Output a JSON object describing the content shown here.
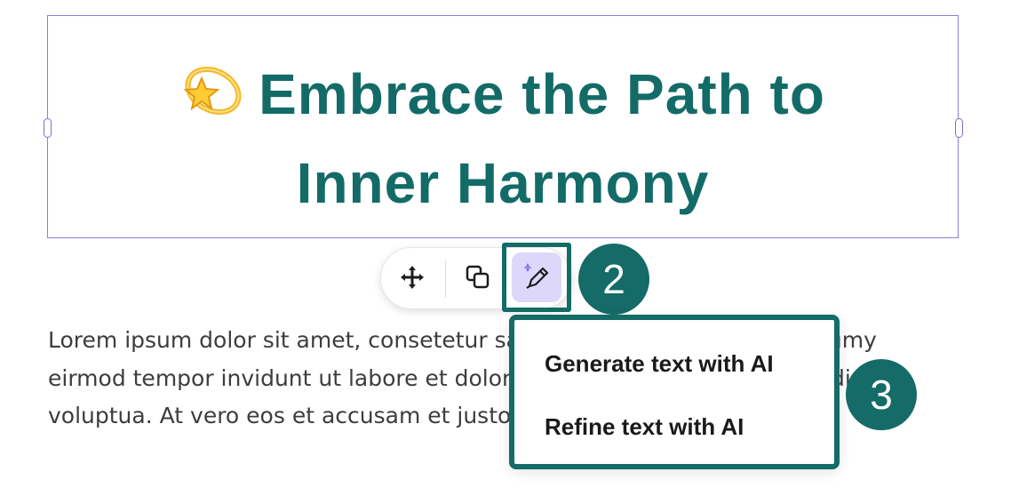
{
  "heading": {
    "emoji": "dizzy-emoji",
    "text": "Embrace the Path to\nInner Harmony"
  },
  "body": {
    "text": "Lorem ipsum dolor sit amet, consetetur sadipscing elitr, sed diam nonumy\neirmod tempor invidunt ut labore et dolore magna aliquyam erat, sed diam\nvoluptua. At vero eos et accusam et justo duo dolores et ea rebum."
  },
  "toolbar": {
    "move_icon": "move-icon",
    "copy_icon": "copy-icon",
    "ai_icon": "ai-pen-icon"
  },
  "steps": {
    "toolbar_step": "2",
    "menu_step": "3"
  },
  "ai_menu": {
    "items": [
      "Generate text with AI",
      "Refine text with AI"
    ]
  },
  "colors": {
    "brand": "#136b68",
    "ai_button_bg": "#ddd8fb",
    "selection_border": "#8b7fd6"
  }
}
